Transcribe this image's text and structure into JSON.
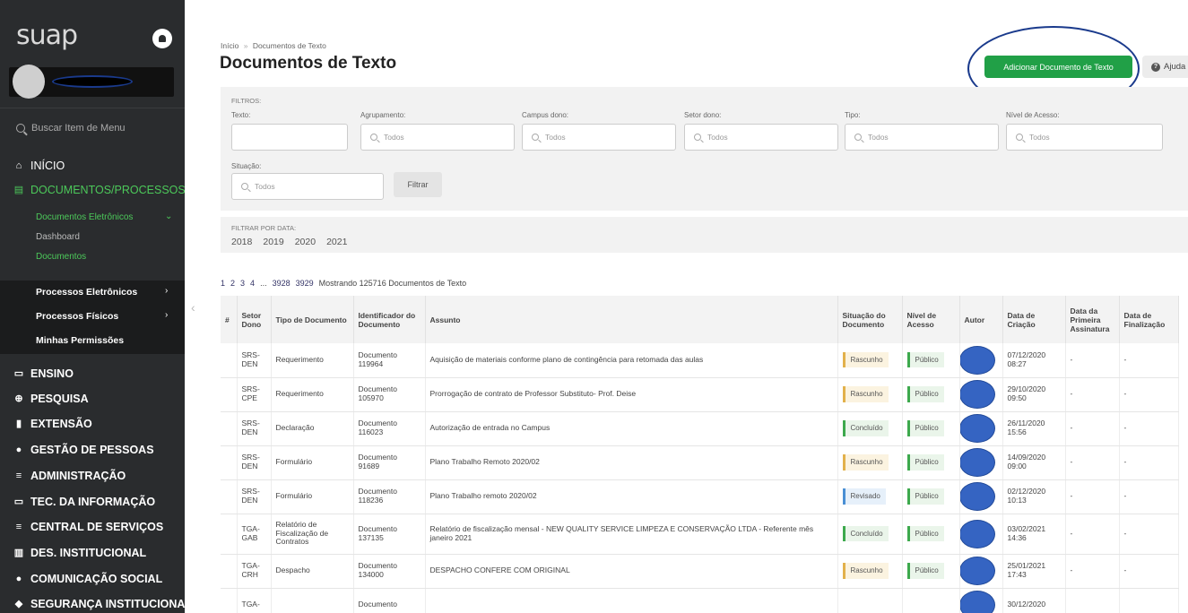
{
  "sidebar": {
    "logo": "suap",
    "search_placeholder": "Buscar Item de Menu",
    "menu": [
      {
        "label": "INÍCIO",
        "icon": "home-icon"
      },
      {
        "label": "DOCUMENTOS/PROCESSOS",
        "icon": "documents-icon"
      },
      {
        "label": "ENSINO",
        "icon": "ensino-icon"
      },
      {
        "label": "PESQUISA",
        "icon": "globe-icon"
      },
      {
        "label": "EXTENSÃO",
        "icon": "chart-icon"
      },
      {
        "label": "GESTÃO DE PESSOAS",
        "icon": "people-icon"
      },
      {
        "label": "ADMINISTRAÇÃO",
        "icon": "list-icon"
      },
      {
        "label": "TEC. DA INFORMAÇÃO",
        "icon": "monitor-icon"
      },
      {
        "label": "CENTRAL DE SERVIÇOS",
        "icon": "list-icon"
      },
      {
        "label": "DES. INSTITUCIONAL",
        "icon": "bar-chart-icon"
      },
      {
        "label": "COMUNICAÇÃO SOCIAL",
        "icon": "chat-icon"
      },
      {
        "label": "SEGURANÇA INSTITUCIONAL",
        "icon": "shield-icon"
      }
    ],
    "submenu": {
      "documentos_eletronicos": "Documentos Eletrônicos",
      "dashboard": "Dashboard",
      "documentos": "Documentos",
      "processos_eletronicos": "Processos Eletrônicos",
      "processos_fisicos": "Processos Físicos",
      "minhas_permissoes": "Minhas Permissões"
    }
  },
  "header": {
    "breadcrumb_home": "Início",
    "breadcrumb_sep": "»",
    "breadcrumb_current": "Documentos de Texto",
    "title": "Documentos de Texto",
    "add_button": "Adicionar Documento de Texto",
    "help_button": "Ajuda"
  },
  "filters": {
    "title": "FILTROS:",
    "texto_label": "Texto:",
    "agrupamento_label": "Agrupamento:",
    "campus_label": "Campus dono:",
    "setor_label": "Setor dono:",
    "tipo_label": "Tipo:",
    "nivel_label": "Nível de Acesso:",
    "situacao_label": "Situação:",
    "placeholder": "Todos",
    "filter_button": "Filtrar"
  },
  "date_filter": {
    "title": "FILTRAR POR DATA:",
    "years": [
      "2018",
      "2019",
      "2020",
      "2021"
    ]
  },
  "pager": {
    "pages": [
      "1",
      "2",
      "3",
      "4"
    ],
    "ellipsis": "...",
    "last_pages": [
      "3928",
      "3929"
    ],
    "summary": "Mostrando 125716 Documentos de Texto"
  },
  "table": {
    "headers": {
      "num": "#",
      "setor": "Setor Dono",
      "tipo": "Tipo de Documento",
      "ident": "Identificador do Documento",
      "assunto": "Assunto",
      "situacao": "Situação do Documento",
      "nivel": "Nível de Acesso",
      "autor": "Autor",
      "data_criacao": "Data de Criação",
      "data_primeira": "Data da Primeira Assinatura",
      "data_final": "Data de Finalização"
    },
    "rows": [
      {
        "setor": "SRS-DEN",
        "tipo": "Requerimento",
        "ident": "Documento 119964",
        "assunto": "Aquisição de materiais conforme plano de contingência para retomada das aulas",
        "situacao": "Rascunho",
        "situacao_kind": "rasc",
        "nivel": "Público",
        "data": "07/12/2020 08:27",
        "primeira": "-",
        "final": "-"
      },
      {
        "setor": "SRS-CPE",
        "tipo": "Requerimento",
        "ident": "Documento 105970",
        "assunto": "Prorrogação de contrato de Professor Substituto- Prof. Deise",
        "situacao": "Rascunho",
        "situacao_kind": "rasc",
        "nivel": "Público",
        "data": "29/10/2020 09:50",
        "primeira": "-",
        "final": "-"
      },
      {
        "setor": "SRS-DEN",
        "tipo": "Declaração",
        "ident": "Documento 116023",
        "assunto": "Autorização de entrada no Campus",
        "situacao": "Concluído",
        "situacao_kind": "conc",
        "nivel": "Público",
        "data": "26/11/2020 15:56",
        "primeira": "-",
        "final": "-"
      },
      {
        "setor": "SRS-DEN",
        "tipo": "Formulário",
        "ident": "Documento 91689",
        "assunto": "Plano Trabalho Remoto 2020/02",
        "situacao": "Rascunho",
        "situacao_kind": "rasc",
        "nivel": "Público",
        "data": "14/09/2020 09:00",
        "primeira": "-",
        "final": "-"
      },
      {
        "setor": "SRS-DEN",
        "tipo": "Formulário",
        "ident": "Documento 118236",
        "assunto": "Plano Trabalho remoto 2020/02",
        "situacao": "Revisado",
        "situacao_kind": "rev",
        "nivel": "Público",
        "data": "02/12/2020 10:13",
        "primeira": "-",
        "final": "-"
      },
      {
        "setor": "TGA-GAB",
        "tipo": "Relatório de Fiscalização de Contratos",
        "ident": "Documento 137135",
        "assunto": "Relatório de fiscalização mensal - NEW QUALITY SERVICE LIMPEZA E CONSERVAÇÃO LTDA - Referente mês janeiro 2021",
        "situacao": "Concluído",
        "situacao_kind": "conc",
        "nivel": "Público",
        "data": "03/02/2021 14:36",
        "primeira": "-",
        "final": "-"
      },
      {
        "setor": "TGA-CRH",
        "tipo": "Despacho",
        "ident": "Documento 134000",
        "assunto": "DESPACHO CONFERE COM ORIGINAL",
        "situacao": "Rascunho",
        "situacao_kind": "rasc",
        "nivel": "Público",
        "data": "25/01/2021 17:43",
        "primeira": "-",
        "final": "-"
      },
      {
        "setor": "TGA-",
        "tipo": "",
        "ident": "Documento",
        "assunto": "",
        "situacao": "",
        "situacao_kind": "",
        "nivel": "",
        "data": "30/12/2020",
        "primeira": "",
        "final": ""
      }
    ]
  },
  "colors": {
    "sidebar_bg": "#2a2c2e",
    "accent_green": "#4cc95a",
    "button_green": "#21a047",
    "annotation_blue": "#1a3a8c"
  }
}
